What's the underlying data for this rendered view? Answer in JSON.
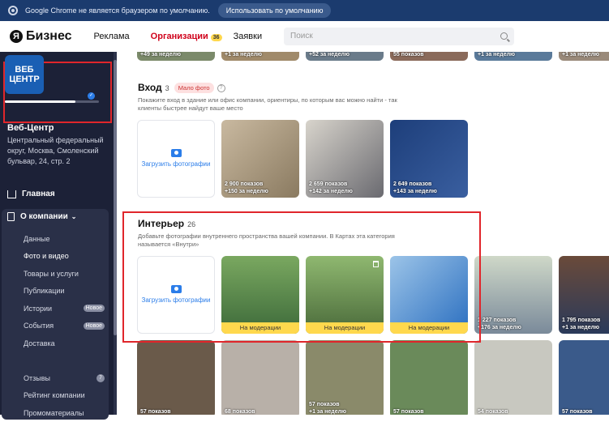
{
  "chrome": {
    "message": "Google Chrome не является браузером по умолчанию.",
    "default_btn": "Использовать по умолчанию"
  },
  "nav": {
    "logo_letter": "Я",
    "logo_text": "Бизнес",
    "items": [
      "Реклама",
      "Организации",
      "Заявки"
    ],
    "badge": "36",
    "search_placeholder": "Поиск"
  },
  "sidebar": {
    "logo_line1": "ВЕБ",
    "logo_line2": "ЦЕНТР",
    "progress": 0.75,
    "name": "Веб-Центр",
    "address": "Центральный федеральный округ, Москва, Смоленский бульвар, 24, стр. 2",
    "home": "Главная",
    "section": "О компании",
    "items": [
      {
        "label": "Данные"
      },
      {
        "label": "Фото и видео"
      },
      {
        "label": "Товары и услуги"
      },
      {
        "label": "Публикации"
      },
      {
        "label": "Истории",
        "badge": "Новое"
      },
      {
        "label": "События",
        "badge": "Новое"
      },
      {
        "label": "Доставка"
      },
      {
        "label": ""
      },
      {
        "label": "Отзывы",
        "badge": "7"
      },
      {
        "label": "Рейтинг компании"
      },
      {
        "label": "Промоматериалы"
      }
    ]
  },
  "top_strip": [
    "+49 за неделю",
    "+1 за неделю",
    "+52 за неделю",
    "55 показов",
    "+1 за неделю",
    "+1 за неделю"
  ],
  "entrance": {
    "title": "Вход",
    "count": "3",
    "tag": "Мало фото",
    "desc": "Покажите вход в здание или офис компании, ориентиры, по которым вас можно найти - так клиенты быстрее найдут ваше место",
    "add": "Загрузить фотографии",
    "tiles": [
      {
        "views": "2 900 показов",
        "week": "+150 за неделю"
      },
      {
        "views": "2 659 показов",
        "week": "+142 за неделю"
      },
      {
        "views": "2 649 показов",
        "week": "+143 за неделю"
      }
    ]
  },
  "interior": {
    "title": "Интерьер",
    "count": "26",
    "desc": "Добавьте фотографии внутреннего пространства вашей компании. В Картах эта категория называется «Внутри»",
    "add": "Загрузить фотографии",
    "moderation": "На модерации",
    "side_tiles": [
      {
        "views": "1 227 показов",
        "week": "+176 за неделю"
      },
      {
        "views": "1 795 показов",
        "week": "+1 за неделю"
      }
    ]
  },
  "bottom": [
    {
      "views": "57 показов",
      "week": ""
    },
    {
      "views": "68 показов",
      "week": ""
    },
    {
      "views": "57 показов",
      "week": "+1 за неделю"
    },
    {
      "views": "57 показов",
      "week": ""
    },
    {
      "views": "54 показов",
      "week": ""
    },
    {
      "views": "57 показов",
      "week": ""
    }
  ]
}
